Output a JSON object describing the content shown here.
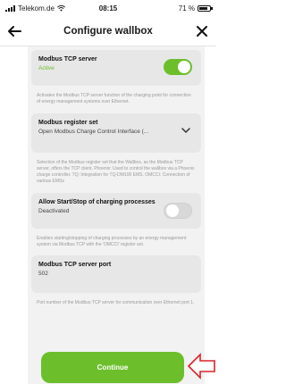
{
  "statusbar": {
    "carrier": "Telekom.de",
    "time": "08:15",
    "battery": "71 %"
  },
  "navbar": {
    "title": "Configure wallbox",
    "back_icon": "arrow-left-icon",
    "close_icon": "close-icon"
  },
  "settings": [
    {
      "title": "Modbus TCP server",
      "value": "Active",
      "toggle": true,
      "description": "Activates the Modbus TCP server function of the charging point for connection of energy management systems over Ethernet."
    },
    {
      "title": "Modbus register set",
      "value": "Open Modbus Charge Control Interface (...",
      "description": "Selection of the Modbus register set that the Wallbox, as the Modbus TCP server, offers the TCP client. Phoenix: Used to control the wallbox via a Phoenix charge controller. TQ: Integration for TQ-DM100 EMS. OMCCI: Connection of various EMSs"
    },
    {
      "title": "Allow Start/Stop of charging processes",
      "value": "Deactivated",
      "toggle": false,
      "description": "Enables starting/stopping of charging processes by an energy management system via Modbus TCP with the 'OMCCI' register set."
    },
    {
      "title": "Modbus TCP server port",
      "value": "502",
      "description": "Port number of the Modbus TCP server for communication over Ethernet port 1."
    }
  ],
  "continue_label": "Continue",
  "colors": {
    "accent": "#6cbf2b",
    "annotation_arrow": "#d9232a"
  }
}
